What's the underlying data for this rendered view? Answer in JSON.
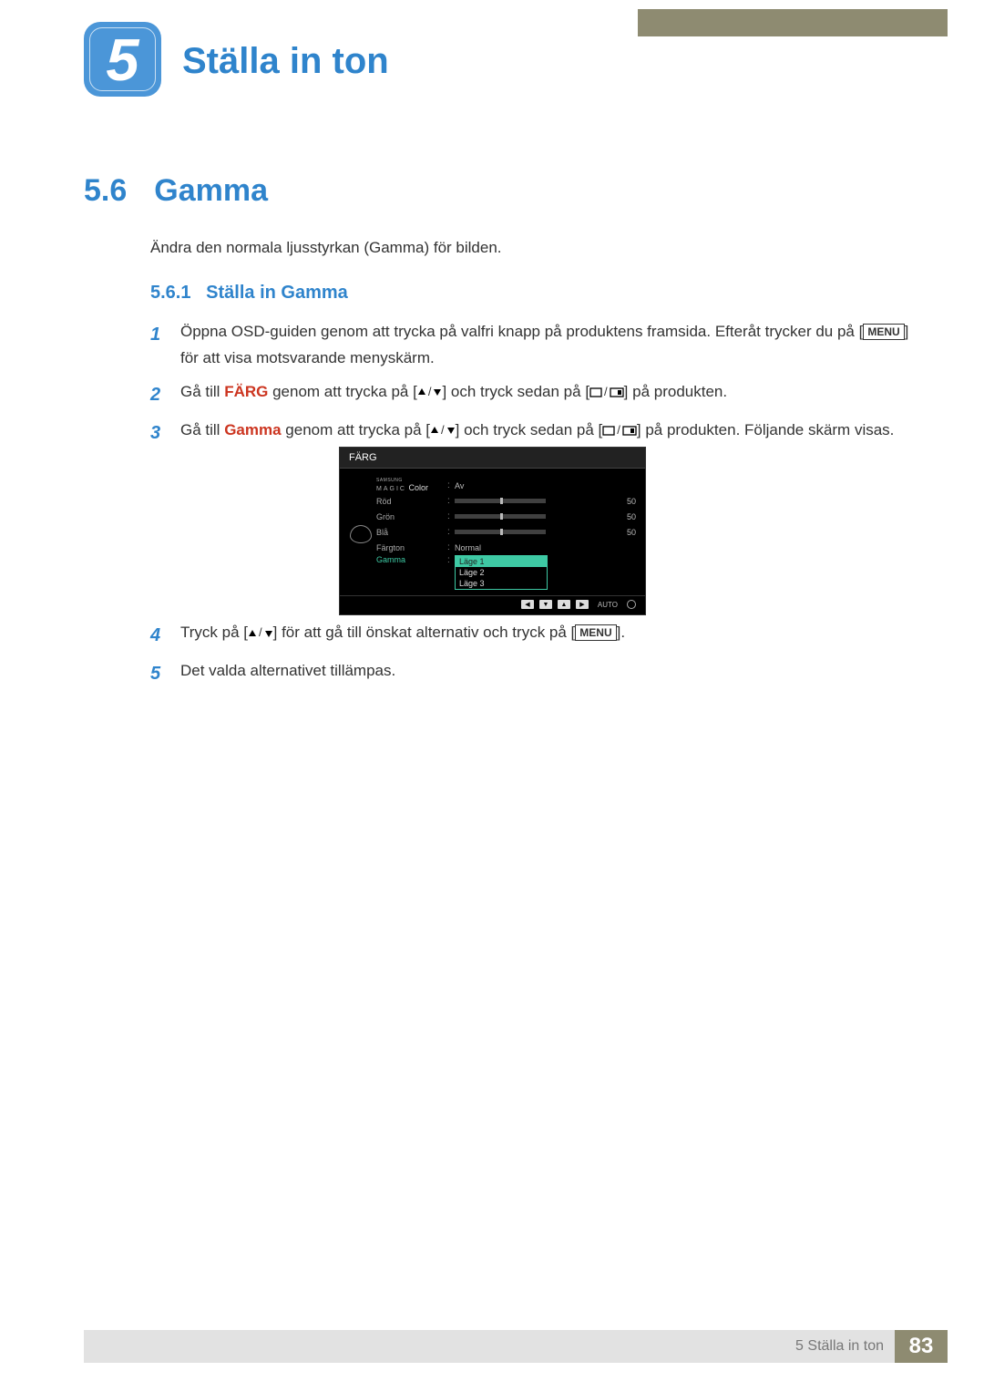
{
  "chapter": {
    "number": "5",
    "title": "Ställa in ton"
  },
  "section": {
    "number": "5.6",
    "name": "Gamma"
  },
  "intro": "Ändra den normala ljusstyrkan (Gamma) för bilden.",
  "subsection": {
    "number": "5.6.1",
    "name": "Ställa in Gamma"
  },
  "labels": {
    "menu": "MENU",
    "auto": "AUTO"
  },
  "steps": {
    "s1a": "Öppna OSD-guiden genom att trycka på valfri knapp på produktens framsida. Efteråt trycker du på [",
    "s1b": "] för att visa motsvarande menyskärm.",
    "s2a": "Gå till ",
    "s2_color": "FÄRG",
    "s2b": " genom att trycka på [",
    "s2c": "] och tryck sedan på [",
    "s2d": "] på produkten.",
    "s3a": "Gå till ",
    "s3_gamma": "Gamma",
    "s3b": " genom att trycka på [",
    "s3c": "] och tryck sedan på [",
    "s3d": "] på produkten. Följande skärm visas.",
    "s4a": "Tryck på [",
    "s4b": "] för att gå till önskat alternativ och tryck på [",
    "s4c": "].",
    "s5": "Det valda alternativet tillämpas."
  },
  "osd": {
    "title": "FÄRG",
    "magic_brand": "SAMSUNG",
    "magic_word": "MAGIC",
    "color_word": "Color",
    "off": "Av",
    "rows": {
      "red": {
        "label": "Röd",
        "value": "50"
      },
      "green": {
        "label": "Grön",
        "value": "50"
      },
      "blue": {
        "label": "Blå",
        "value": "50"
      }
    },
    "tone": {
      "label": "Färgton",
      "value": "Normal"
    },
    "gamma": {
      "label": "Gamma",
      "opt1": "Läge 1",
      "opt2": "Läge 2",
      "opt3": "Läge 3"
    }
  },
  "footer": {
    "text": "5 Ställa in ton",
    "page": "83"
  }
}
